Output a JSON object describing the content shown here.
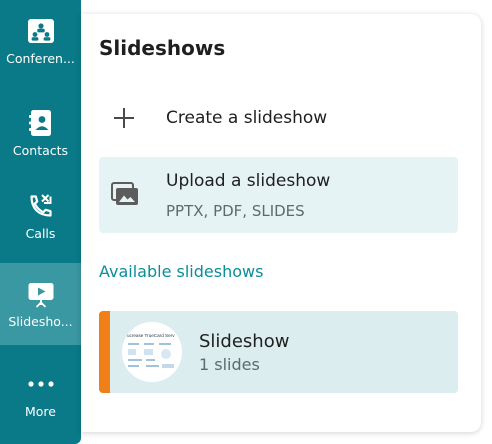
{
  "sidebar": {
    "items": [
      {
        "label": "Conferen...",
        "icon": "conference-icon",
        "active": false
      },
      {
        "label": "Contacts",
        "icon": "contacts-icon",
        "active": false
      },
      {
        "label": "Calls",
        "icon": "calls-icon",
        "active": false
      },
      {
        "label": "Slidesho...",
        "icon": "slideshow-icon",
        "active": true
      },
      {
        "label": "More",
        "icon": "more-icon",
        "active": false
      }
    ]
  },
  "panel": {
    "title": "Slideshows",
    "create_label": "Create a slideshow",
    "upload_title": "Upload a slideshow",
    "upload_subtitle": "PPTX, PDF, SLIDES",
    "section_title": "Available slideshows",
    "slideshows": [
      {
        "title": "Slideshow",
        "count": "1 slides",
        "thumb_title": "ucrease TrueCard Serv"
      }
    ]
  },
  "colors": {
    "sidebar_bg": "#0a7a88",
    "sidebar_active": "#3a98a3",
    "accent_orange": "#f07f18",
    "section_teal": "#0a8e99",
    "upload_bg": "#e6f3f5",
    "item_bg": "#dcedf0"
  }
}
